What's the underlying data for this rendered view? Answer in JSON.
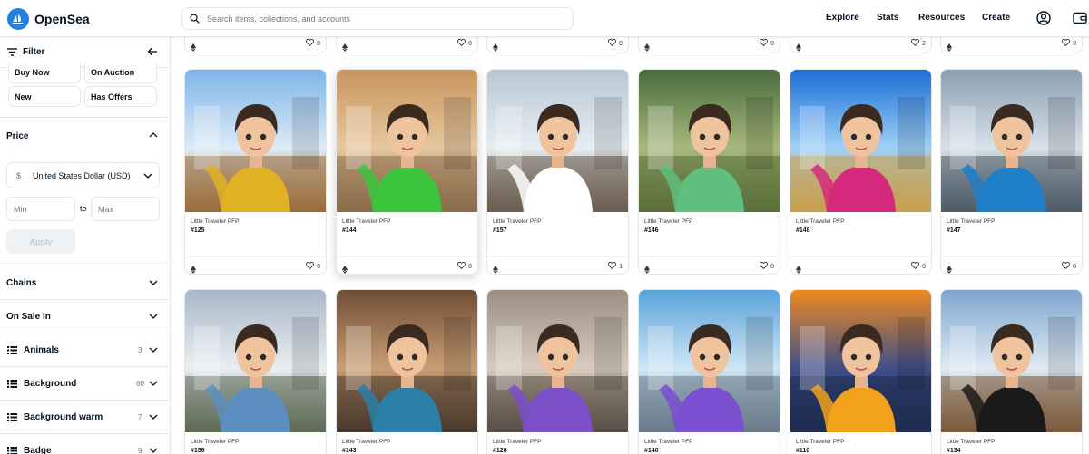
{
  "header": {
    "brand": "OpenSea",
    "search_placeholder": "Search items, collections, and accounts",
    "nav": [
      "Explore",
      "Stats",
      "Resources",
      "Create"
    ]
  },
  "sidebar": {
    "filter_label": "Filter",
    "status_chips": [
      "Buy Now",
      "On Auction",
      "New",
      "Has Offers"
    ],
    "price": {
      "title": "Price",
      "currency": "United States Dollar (USD)",
      "currency_symbol": "$",
      "min_placeholder": "Min",
      "max_placeholder": "Max",
      "to_label": "to",
      "apply_label": "Apply"
    },
    "sections": [
      {
        "title": "Chains",
        "count": "",
        "list_icon": false
      },
      {
        "title": "On Sale In",
        "count": "",
        "list_icon": false
      },
      {
        "title": "Animals",
        "count": "3",
        "list_icon": true
      },
      {
        "title": "Background",
        "count": "60",
        "list_icon": true
      },
      {
        "title": "Background warm",
        "count": "7",
        "list_icon": true
      },
      {
        "title": "Badge",
        "count": "9",
        "list_icon": true
      }
    ]
  },
  "grid": {
    "top_row_likes": [
      "0",
      "0",
      "0",
      "0",
      "2",
      "0"
    ],
    "row1": [
      {
        "collection": "Little Traveler PFP",
        "id": "#125",
        "likes": "0"
      },
      {
        "collection": "Little Traveler PFP",
        "id": "#144",
        "likes": "0",
        "selected": true
      },
      {
        "collection": "Little Traveler PFP",
        "id": "#157",
        "likes": "1"
      },
      {
        "collection": "Little Traveler PFP",
        "id": "#146",
        "likes": "0"
      },
      {
        "collection": "Little Traveler PFP",
        "id": "#148",
        "likes": "0"
      },
      {
        "collection": "Little Traveler PFP",
        "id": "#147",
        "likes": "0"
      }
    ],
    "row2": [
      {
        "collection": "Little Traveler PFP",
        "id": "#156"
      },
      {
        "collection": "Little Traveler PFP",
        "id": "#143"
      },
      {
        "collection": "Little Traveler PFP",
        "id": "#126"
      },
      {
        "collection": "Little Traveler PFP",
        "id": "#140"
      },
      {
        "collection": "Little Traveler PFP",
        "id": "#110"
      },
      {
        "collection": "Little Traveler PFP",
        "id": "#134"
      }
    ]
  },
  "colors": {
    "brand": "#2081e2",
    "text": "#04111d",
    "muted": "#707a83",
    "border": "#e5e8eb"
  }
}
